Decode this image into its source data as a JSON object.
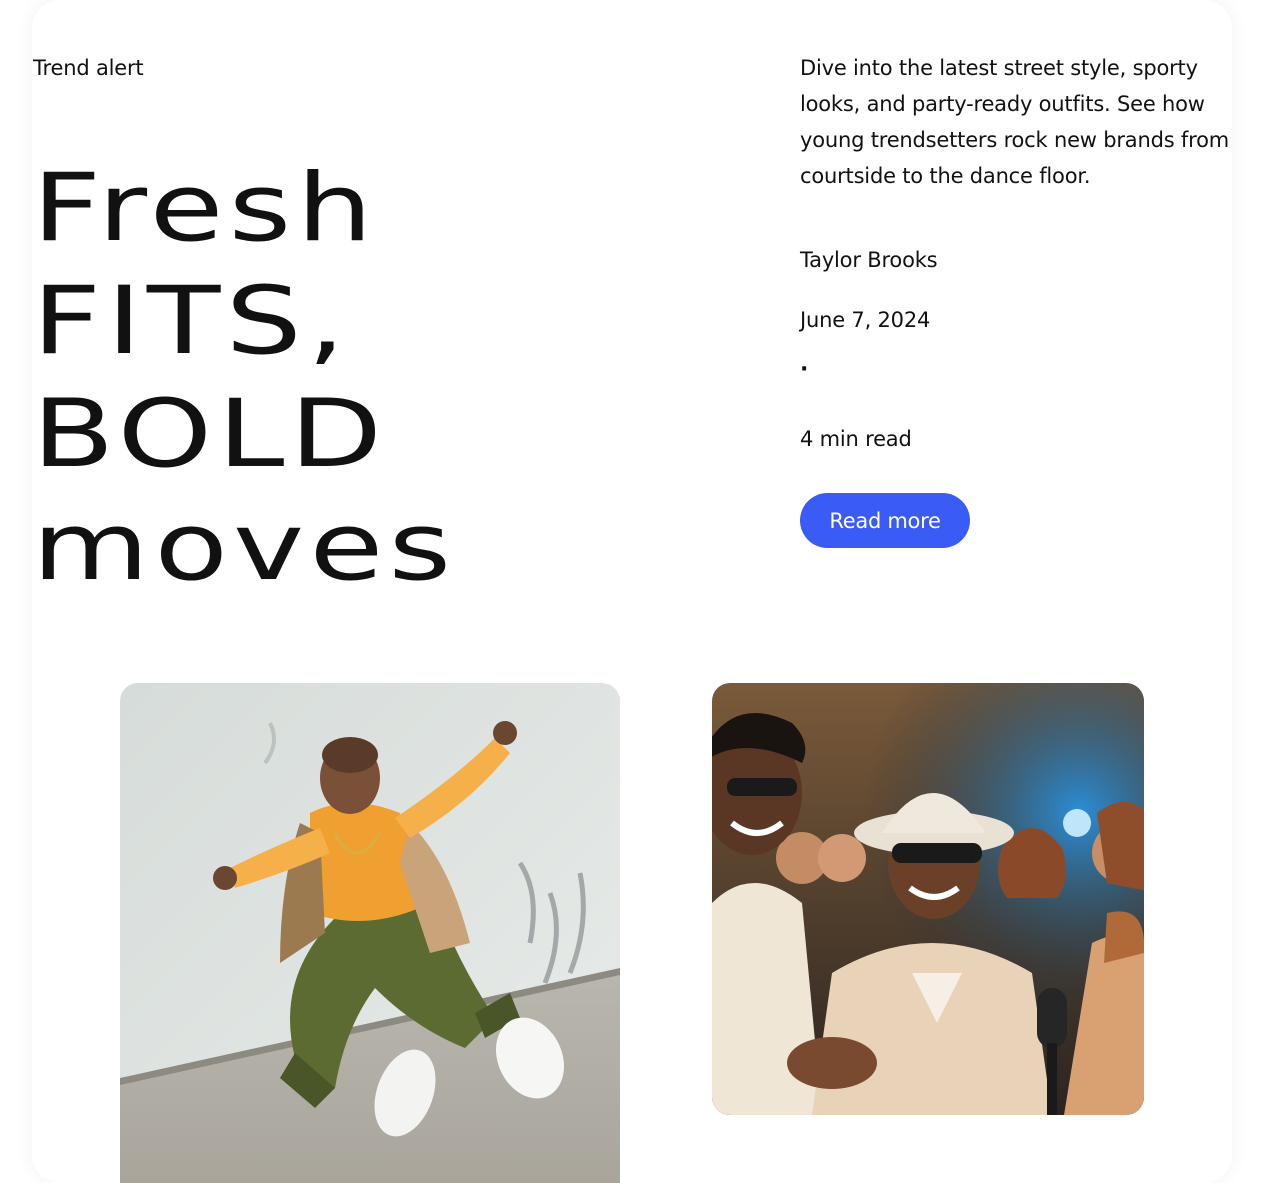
{
  "article": {
    "eyebrow": "Trend alert",
    "headline_lines": [
      "Fresh",
      "FITS,",
      "BOLD",
      "moves"
    ],
    "intro": "Dive into the latest street style, sporty looks, and party-ready outfits. See how young trendsetters rock new brands from courtside to the dance floor.",
    "author": "Taylor Brooks",
    "date": "June 7, 2024",
    "separator": "·",
    "read_time": "4 min read",
    "cta_label": "Read more"
  },
  "colors": {
    "accent": "#3a5bf5",
    "text": "#111111",
    "background": "#ffffff"
  },
  "images": [
    {
      "name": "dancer-photo",
      "alt": "breakdancer in orange jacket"
    },
    {
      "name": "party-photo",
      "alt": "smiling crowd at party"
    }
  ]
}
